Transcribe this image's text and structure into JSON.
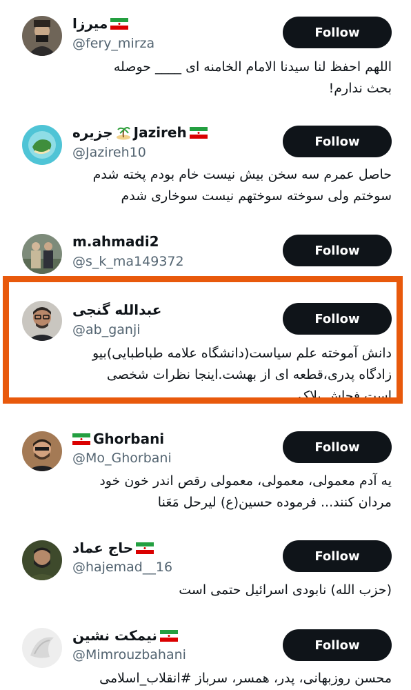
{
  "accent_color": "#e8590c",
  "button_color": "#0f1419",
  "users": [
    {
      "name": "میرزا",
      "handle": "@fery_mirza",
      "flag": "iran-flag-icon",
      "follow_label": "Follow",
      "bio": "اللهم احفظ لنا سیدنا الامام الخامنه ای ____ حوصله\nبحث ندارم!"
    },
    {
      "name": "Jazireh",
      "name_alt": "جزیره",
      "handle": "@Jazireh10",
      "flag": "iran-flag-icon",
      "emoji": "island-icon",
      "follow_label": "Follow",
      "bio": "حاصل عمرم سه سخن بیش نیست خام بودم پخته شدم\nسوختم ولی سوخته سوختهم نیست سوخاری شدم"
    },
    {
      "name": "m.ahmadi2",
      "handle": "@s_k_ma149372",
      "follow_label": "Follow",
      "bio": ""
    },
    {
      "name": "عبدالله گنجی",
      "handle": "@ab_ganji",
      "follow_label": "Follow",
      "bio": "دانش آموخته علم سیاست(دانشگاه علامه طباطبایی)بیو\nزادگاه پدری،قطعه ای از بهشت.اینجا نظرات شخصی\nاست.فحاش بلاک"
    },
    {
      "name": "Ghorbani",
      "handle": "@Mo_Ghorbani",
      "flag": "iran-flag-icon",
      "follow_label": "Follow",
      "bio": "یه آدم معمولی، معمولی، معمولی رقص اندر خون خود\nمردان کنند... فرموده حسین(ع) لیرحل مَعَنا"
    },
    {
      "name": "حاج عماد",
      "handle": "@hajemad__16",
      "flag": "iran-flag-icon",
      "follow_label": "Follow",
      "bio": "(حزب الله) نابودی اسرائیل حتمی است"
    },
    {
      "name": "نیمکت نشین",
      "handle": "@Mimrouzbahani",
      "flag": "iran-flag-icon",
      "follow_label": "Follow",
      "bio": "محسن روزبهانی، پدر، همسر، سرباز #انقلاب_اسلامی"
    }
  ]
}
